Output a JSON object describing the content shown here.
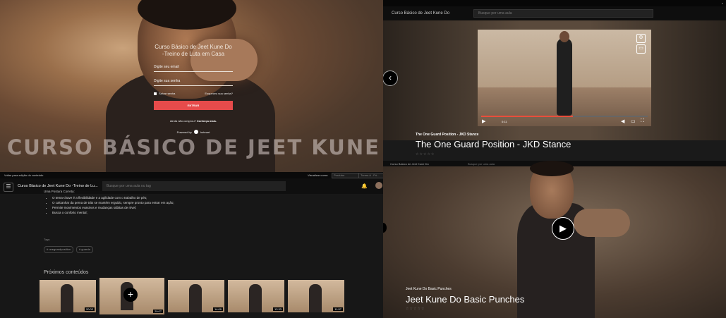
{
  "login": {
    "title": "Curso Básico de Jeet Kune Do -Treino de Luta em Casa",
    "email_placeholder": "Digite seu email",
    "password_placeholder": "Digite sua senha",
    "remember": "Salvar senha",
    "forgot": "Esqueceu sua senha?",
    "submit": "ENTRAR",
    "signup_prefix": "Ainda não comprou?",
    "signup_link": "Conheça mais.",
    "powered": "Powered by",
    "powered_brand": "hotmart",
    "banner": "CURSO BÁSICO DE JEET KUNE DO"
  },
  "video1": {
    "topbar_right": "×",
    "crumb": "Curso Básico de Jeet Kune Do",
    "search_placeholder": "Busque por uma aula",
    "time": "0:11",
    "progress": 0.55,
    "subtitle": "The One Guard Position - JKD Stance",
    "title": "The One Guard Position - JKD Stance",
    "rating": "☆☆☆☆☆",
    "back_arrow": "‹"
  },
  "course": {
    "edit_label": "Voltar para edição do conteúdo",
    "view_label": "Visualizar como:",
    "view_option1": "Produtor",
    "view_option2": "Turma A - Pú...",
    "menu_icon": "☰",
    "title": "Curso Básico de Jeet Kune Do -Treino de Lu...",
    "search_placeholder": "Busque por uma aula ou tag",
    "bell_icon": "🔔",
    "lesson_heading": "Uma Postura Correta:",
    "bullets": [
      "O tema-chave é a flexibilidade e a agilidade com o trabalho de pés;",
      "O calcanhar da perna de trás se mantém erguido, sempre pronto para entrar em ação;",
      "Permite movimentos evasivos e mudanças súbitas de nível;",
      "Busca o conforto mental;"
    ],
    "tags_label": "Tags",
    "tags": [
      "# oneguardposition",
      "# guarda"
    ],
    "next_label": "Próximos conteúdos",
    "thumbs": [
      {
        "duration": "20:02"
      },
      {
        "duration": "20:07"
      },
      {
        "duration": "14:09"
      },
      {
        "duration": "12:33"
      },
      {
        "duration": "11:57"
      }
    ],
    "add_icon": "+"
  },
  "video2": {
    "topbar_left": "Curso Básico de Jeet Kune Do",
    "topbar_search": "Busque por uma aula",
    "play_icon": "▶",
    "subtitle": "Jeet Kune Do Basic Punches",
    "title": "Jeet Kune Do Basic Punches",
    "rating": "☆☆☆☆☆"
  }
}
